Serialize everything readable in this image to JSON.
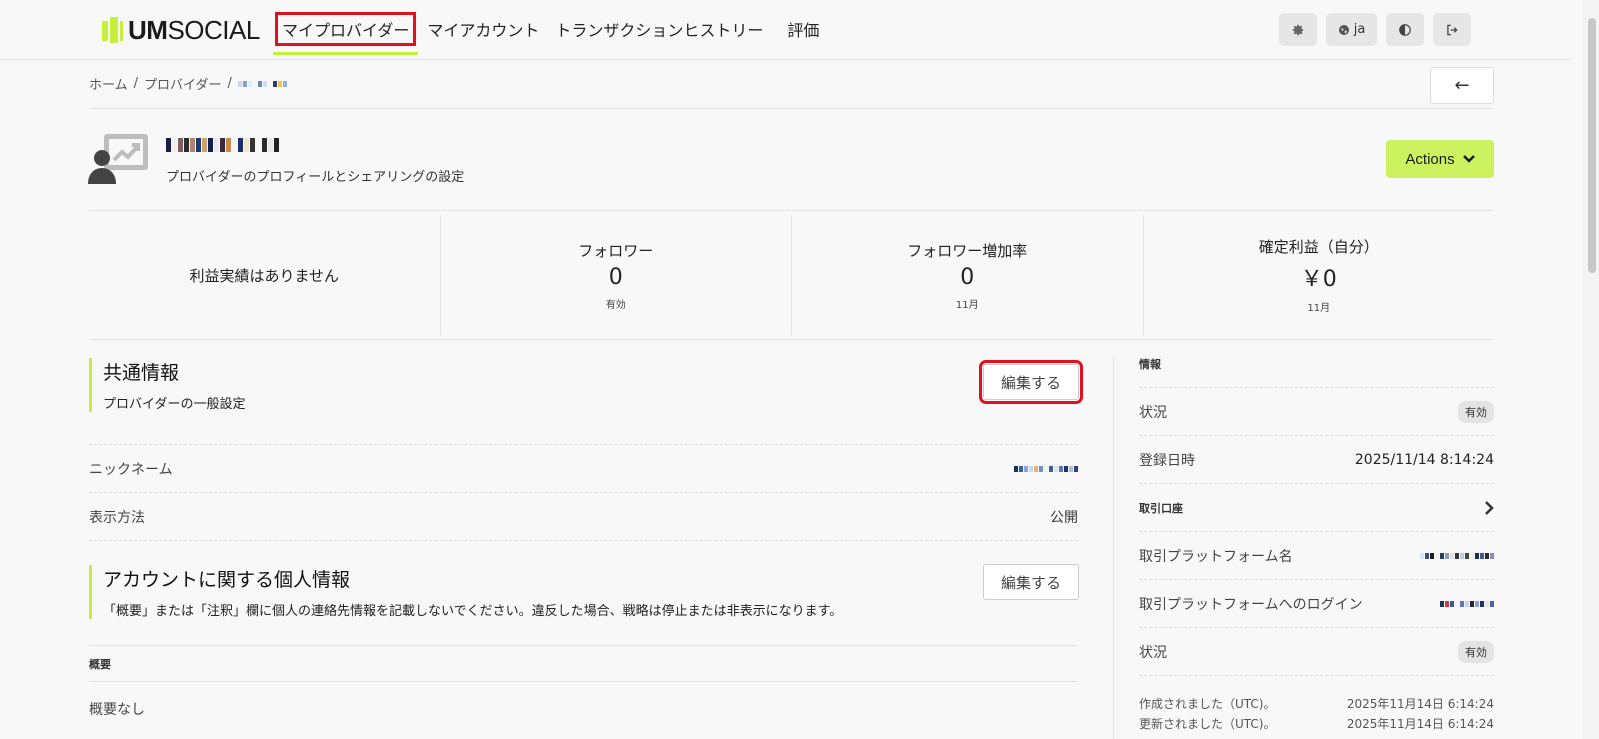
{
  "app": {
    "logo_bold": "UM",
    "logo_light": "SOCIAL"
  },
  "nav": {
    "items": [
      {
        "label": "マイプロバイダー",
        "active": true
      },
      {
        "label": "マイアカウント"
      },
      {
        "label": "トランザクションヒストリー"
      },
      {
        "label": "評価"
      }
    ]
  },
  "header_buttons": {
    "language": "ja",
    "icons": [
      "gear-icon",
      "globe-icon",
      "contrast-icon",
      "logout-icon"
    ]
  },
  "breadcrumb": {
    "home": "ホーム",
    "providers": "プロバイダー",
    "separator": "/"
  },
  "back_button": {
    "label": "←"
  },
  "profile": {
    "subtitle": "プロバイダーのプロフィールとシェアリングの設定",
    "actions_label": "Actions"
  },
  "stats": {
    "no_profit": "利益実績はありません",
    "items": [
      {
        "title": "フォロワー",
        "value": "0",
        "sub": "有効"
      },
      {
        "title": "フォロワー増加率",
        "value": "0",
        "sub": "11月"
      },
      {
        "title": "確定利益（自分）",
        "value": "￥0",
        "sub": "11月"
      }
    ]
  },
  "common_info": {
    "title": "共通情報",
    "desc": "プロバイダーの一般設定",
    "edit_label": "編集する",
    "rows": [
      {
        "label": "ニックネーム",
        "value": ""
      },
      {
        "label": "表示方法",
        "value": "公開"
      }
    ]
  },
  "personal_info": {
    "title": "アカウントに関する個人情報",
    "desc": "「概要」または「注釈」欄に個人の連絡先情報を記載しないでください。違反した場合、戦略は停止または非表示になります。",
    "edit_label": "編集する",
    "summary_header": "概要",
    "summary_value": "概要なし"
  },
  "info_panel": {
    "title": "情報",
    "status_label": "状況",
    "status_value": "有効",
    "registered_label": "登録日時",
    "registered_value": "2025/11/14 8:14:24",
    "trading_account_label": "取引口座",
    "platform_name_label": "取引プラットフォーム名",
    "platform_login_label": "取引プラットフォームへのログイン",
    "status2_label": "状況",
    "status2_value": "有効",
    "created_label": "作成されました（UTC)。",
    "created_value": "2025年11月14日 6:14:24",
    "updated_label": "更新されました（UTC)。",
    "updated_value": "2025年11月14日 6:14:24"
  },
  "colors": {
    "accent": "#c5ef3a",
    "actions_bg": "#ccf260",
    "highlight": "#e0111c"
  }
}
